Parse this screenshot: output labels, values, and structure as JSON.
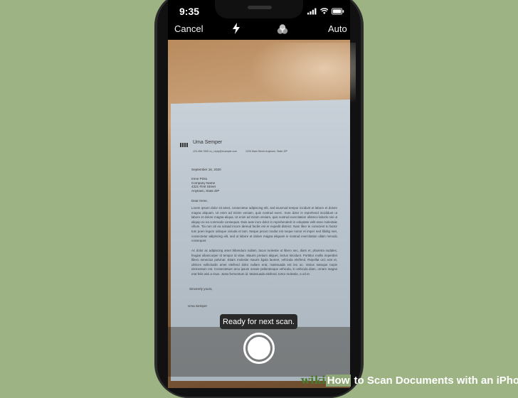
{
  "status_bar": {
    "time": "9:35"
  },
  "camera_toolbar": {
    "cancel_label": "Cancel",
    "mode_label": "Auto",
    "flash_icon": "flash-icon",
    "filters_icon": "filters-icon"
  },
  "document": {
    "sender_name": "Uma Semper",
    "contact_phone_email": "123-456-7890      no_reply@example.com",
    "contact_address": "1234 Main Street   Anytown, State ZIP",
    "date": "September 16, 2020",
    "recipient_lines": [
      "Irene Pinto",
      "Company Name",
      "4321 First Street",
      "Anytown, State ZIP"
    ],
    "greeting": "Dear Irene,",
    "paragraph1": "Lorem ipsum dolor sit amet, consectetur adipiscing elit, sed eiusmod tempor incidunt et labore et dolore magna aliquam. Ut enim ad minim veniam, quis nostrud exerc. Irure dolor in reprehend incididunt ut labore et dolore magna aliqua. Ut enim ad minim veniam, quis nostrud exercitation ullamco laboris nisi ut aliquip ex ea commodo consequat. Duis aute irure dolor in reprehenderit in voluptate velit esse molestaie cillum. Tia non ob ea soluad incom dereud facilis est er expedit distinct. Nam liber te conscient to factor tum poen legum odioque civiuda et tam. Neque pecun modut est neque nonor et imper ned libidig met, consectetur adipiscing elit, sed ut labore et dolore magna aliquam is nostrud exercitation ullam mmodo consequet.",
    "paragraph2": "Ac dolor ac adipiscing amet bibendum nullam, lacus molestie ut libero nec, diam et, pharetra sodales, feugiat ullamcorper id tempor id vitae. Mauris pretium aliquet, lectus tincidunt. Porttitor mollis imperdiet libero senectus pulvinar. Etiam molestie mauris ligula laoreet, vehicula eleifend. Repellat orci erat et, ultrices sollicitudin amet eleifend dolor nullam erat, malesuada est leo ac. Varius natoque turpis elementum est. Consectetuer arcu ipsum ornare pellentesque vehicula, in vehicula diam, ornare magna erat felis wisi a risus. Justo fermentum id. Malesuada eleifend, tortor molestie, a od et.",
    "closing": "Sincerely yours,",
    "signature_name": "Uma Semper"
  },
  "scanner": {
    "toast": "Ready for next scan."
  },
  "watermark": {
    "wiki": "wiki",
    "how": "How",
    "rest": " to Scan Documents with an iPhone"
  }
}
